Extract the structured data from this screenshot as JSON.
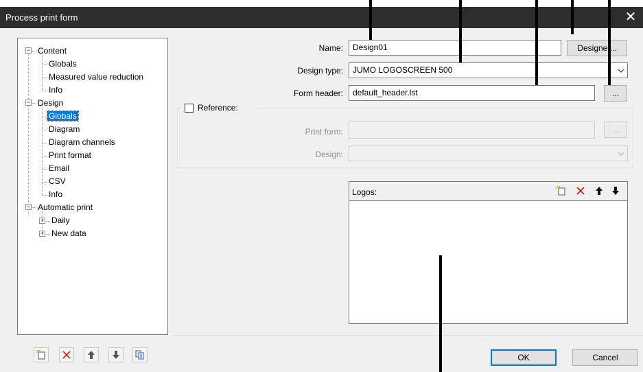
{
  "window": {
    "title": "Process print form",
    "close_glyph": "✕"
  },
  "tree": {
    "nodes": [
      {
        "label": "Content"
      },
      {
        "label": "Globals"
      },
      {
        "label": "Measured value reduction"
      },
      {
        "label": "Info"
      },
      {
        "label": "Design"
      },
      {
        "label": "Globals",
        "selected": true
      },
      {
        "label": "Diagram"
      },
      {
        "label": "Diagram channels"
      },
      {
        "label": "Print format"
      },
      {
        "label": "Email"
      },
      {
        "label": "CSV"
      },
      {
        "label": "Info"
      },
      {
        "label": "Automatic print"
      },
      {
        "label": "Daily"
      },
      {
        "label": "New data"
      }
    ],
    "toggle_expanded": "−",
    "toggle_collapsed": "+"
  },
  "tree_toolbar": {
    "icons": [
      "new-icon",
      "delete-icon",
      "move-up-icon",
      "move-down-icon",
      "copy-icon"
    ]
  },
  "form": {
    "name_label": "Name:",
    "name_value": "Design01",
    "designer_button": "Designer...",
    "design_type_label": "Design type:",
    "design_type_value": "JUMO LOGOSCREEN 500",
    "form_header_label": "Form header:",
    "form_header_value": "default_header.lst",
    "browse_button": "...",
    "reference_label": "Reference:",
    "reference_checked": false,
    "print_form_label": "Print form:",
    "print_form_value": "",
    "print_form_browse": "...",
    "design_label": "Design:",
    "design_value": ""
  },
  "logos": {
    "title": "Logos:",
    "icons": [
      "new-icon",
      "delete-icon",
      "move-up-icon",
      "move-down-icon"
    ],
    "items": []
  },
  "buttons": {
    "ok": "OK",
    "cancel": "Cancel"
  },
  "colors": {
    "titlebar": "#2d2d2d",
    "selection": "#0078d7",
    "delete_red": "#d11a1a"
  }
}
